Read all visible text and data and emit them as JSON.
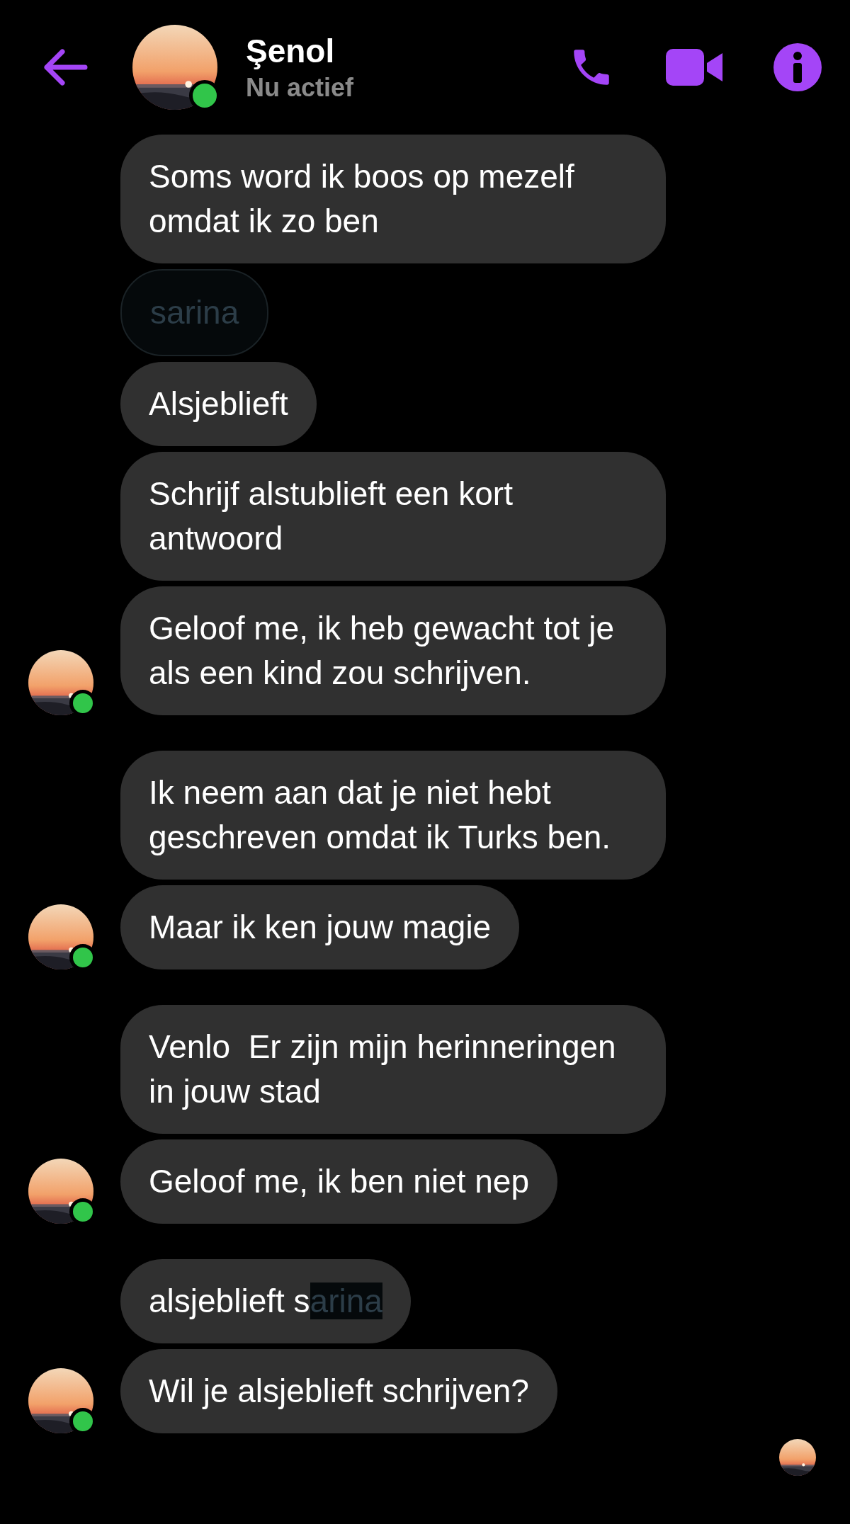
{
  "header": {
    "name": "Şenol",
    "status": "Nu actief",
    "online": true
  },
  "groups": [
    {
      "sender_online": true,
      "messages": [
        {
          "parts": [
            {
              "text": "Soms word ik boos op mezelf omdat ik zo ben",
              "redacted": false
            }
          ]
        },
        {
          "parts": [
            {
              "text": "sarina",
              "redacted": true
            }
          ]
        },
        {
          "parts": [
            {
              "text": "Alsjeblieft",
              "redacted": false
            }
          ]
        },
        {
          "parts": [
            {
              "text": "Schrijf alstublieft een kort antwoord",
              "redacted": false
            }
          ]
        },
        {
          "parts": [
            {
              "text": "Geloof me, ik heb gewacht tot je als een kind zou schrijven.",
              "redacted": false
            }
          ]
        }
      ]
    },
    {
      "sender_online": true,
      "messages": [
        {
          "parts": [
            {
              "text": "Ik neem aan dat je niet hebt geschreven omdat ik Turks ben.",
              "redacted": false
            }
          ]
        },
        {
          "parts": [
            {
              "text": "Maar ik ken jouw magie",
              "redacted": false
            }
          ]
        }
      ]
    },
    {
      "sender_online": true,
      "messages": [
        {
          "parts": [
            {
              "text": "Venlo  Er zijn mijn herinneringen in jouw stad",
              "redacted": false
            }
          ]
        },
        {
          "parts": [
            {
              "text": "Geloof me, ik ben niet nep",
              "redacted": false
            }
          ]
        }
      ]
    },
    {
      "sender_online": true,
      "messages": [
        {
          "parts": [
            {
              "text": "alsjeblieft s",
              "redacted": false
            },
            {
              "text": "arina",
              "redacted": true
            }
          ]
        },
        {
          "parts": [
            {
              "text": "Wil je alsjeblieft schrijven?",
              "redacted": false
            }
          ]
        }
      ]
    }
  ]
}
